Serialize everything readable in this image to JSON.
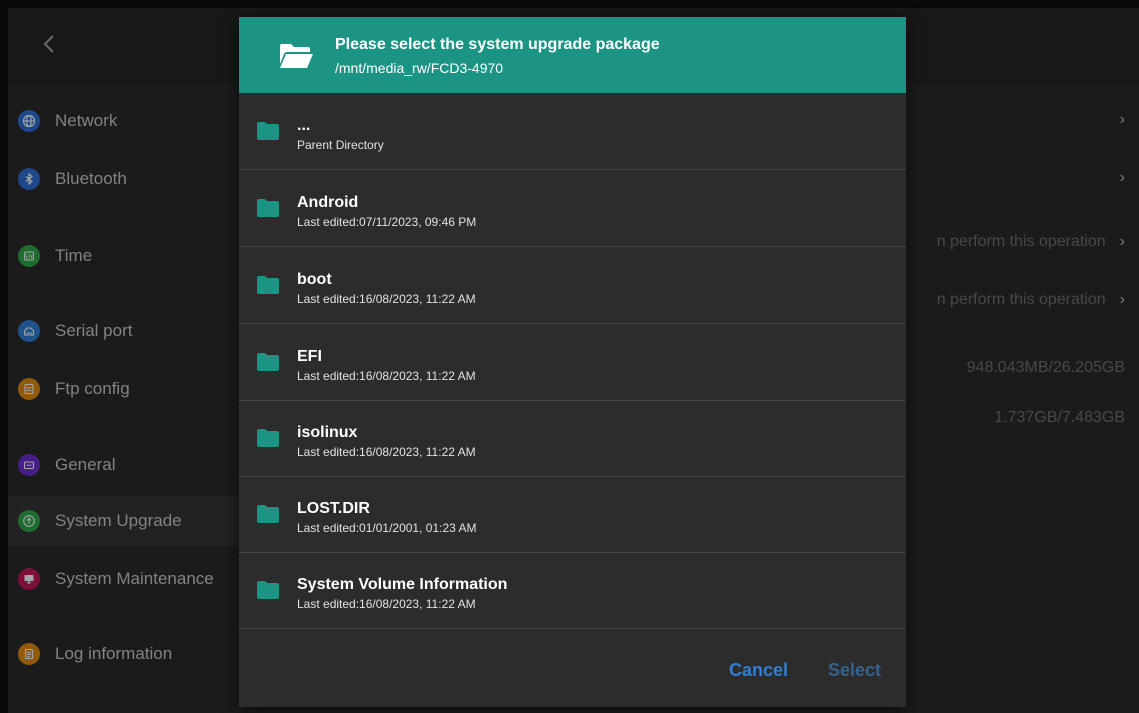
{
  "accent_color": "#1c9484",
  "background": {
    "back_icon": "chevron-left-icon",
    "sidebar": {
      "items": [
        {
          "label": "Network",
          "icon": "globe-icon",
          "color": "#2f6fd6"
        },
        {
          "label": "Bluetooth",
          "icon": "bluetooth-icon",
          "color": "#2f6fd6"
        },
        {
          "label": "Time",
          "icon": "language-icon",
          "color": "#2fa84b"
        },
        {
          "label": "Serial port",
          "icon": "serial-port-icon",
          "color": "#2f7fd6"
        },
        {
          "label": "Ftp config",
          "icon": "storage-icon",
          "color": "#e08a12"
        },
        {
          "label": "General",
          "icon": "general-icon",
          "color": "#6a2fcf"
        },
        {
          "label": "System Upgrade",
          "icon": "upgrade-arrow-icon",
          "color": "#2fa84b",
          "active": true
        },
        {
          "label": "System Maintenance",
          "icon": "monitor-icon",
          "color": "#c2185b"
        },
        {
          "label": "Log information",
          "icon": "document-icon",
          "color": "#e08a12"
        }
      ]
    },
    "right_rows": [
      {
        "text": "",
        "chevron": true
      },
      {
        "text": "",
        "chevron": true
      },
      {
        "text": "n perform this operation",
        "chevron": true
      },
      {
        "text": "n perform this operation",
        "chevron": true
      },
      {
        "text": "948.043MB/26.205GB",
        "chevron": false
      },
      {
        "text": "1.737GB/7.483GB",
        "chevron": false
      }
    ]
  },
  "dialog": {
    "icon": "folder-open-icon",
    "title": "Please select the system upgrade package",
    "path": "/mnt/media_rw/FCD3-4970",
    "files": [
      {
        "name": "...",
        "subtitle": "Parent Directory",
        "icon": "folder-icon"
      },
      {
        "name": "Android",
        "subtitle": "Last edited:07/11/2023, 09:46 PM",
        "icon": "folder-icon"
      },
      {
        "name": "boot",
        "subtitle": "Last edited:16/08/2023, 11:22 AM",
        "icon": "folder-icon"
      },
      {
        "name": "EFI",
        "subtitle": "Last edited:16/08/2023, 11:22 AM",
        "icon": "folder-icon"
      },
      {
        "name": "isolinux",
        "subtitle": "Last edited:16/08/2023, 11:22 AM",
        "icon": "folder-icon"
      },
      {
        "name": "LOST.DIR",
        "subtitle": "Last edited:01/01/2001, 01:23 AM",
        "icon": "folder-icon"
      },
      {
        "name": "System Volume Information",
        "subtitle": "Last edited:16/08/2023, 11:22 AM",
        "icon": "folder-icon"
      }
    ],
    "cancel_label": "Cancel",
    "select_label": "Select"
  }
}
